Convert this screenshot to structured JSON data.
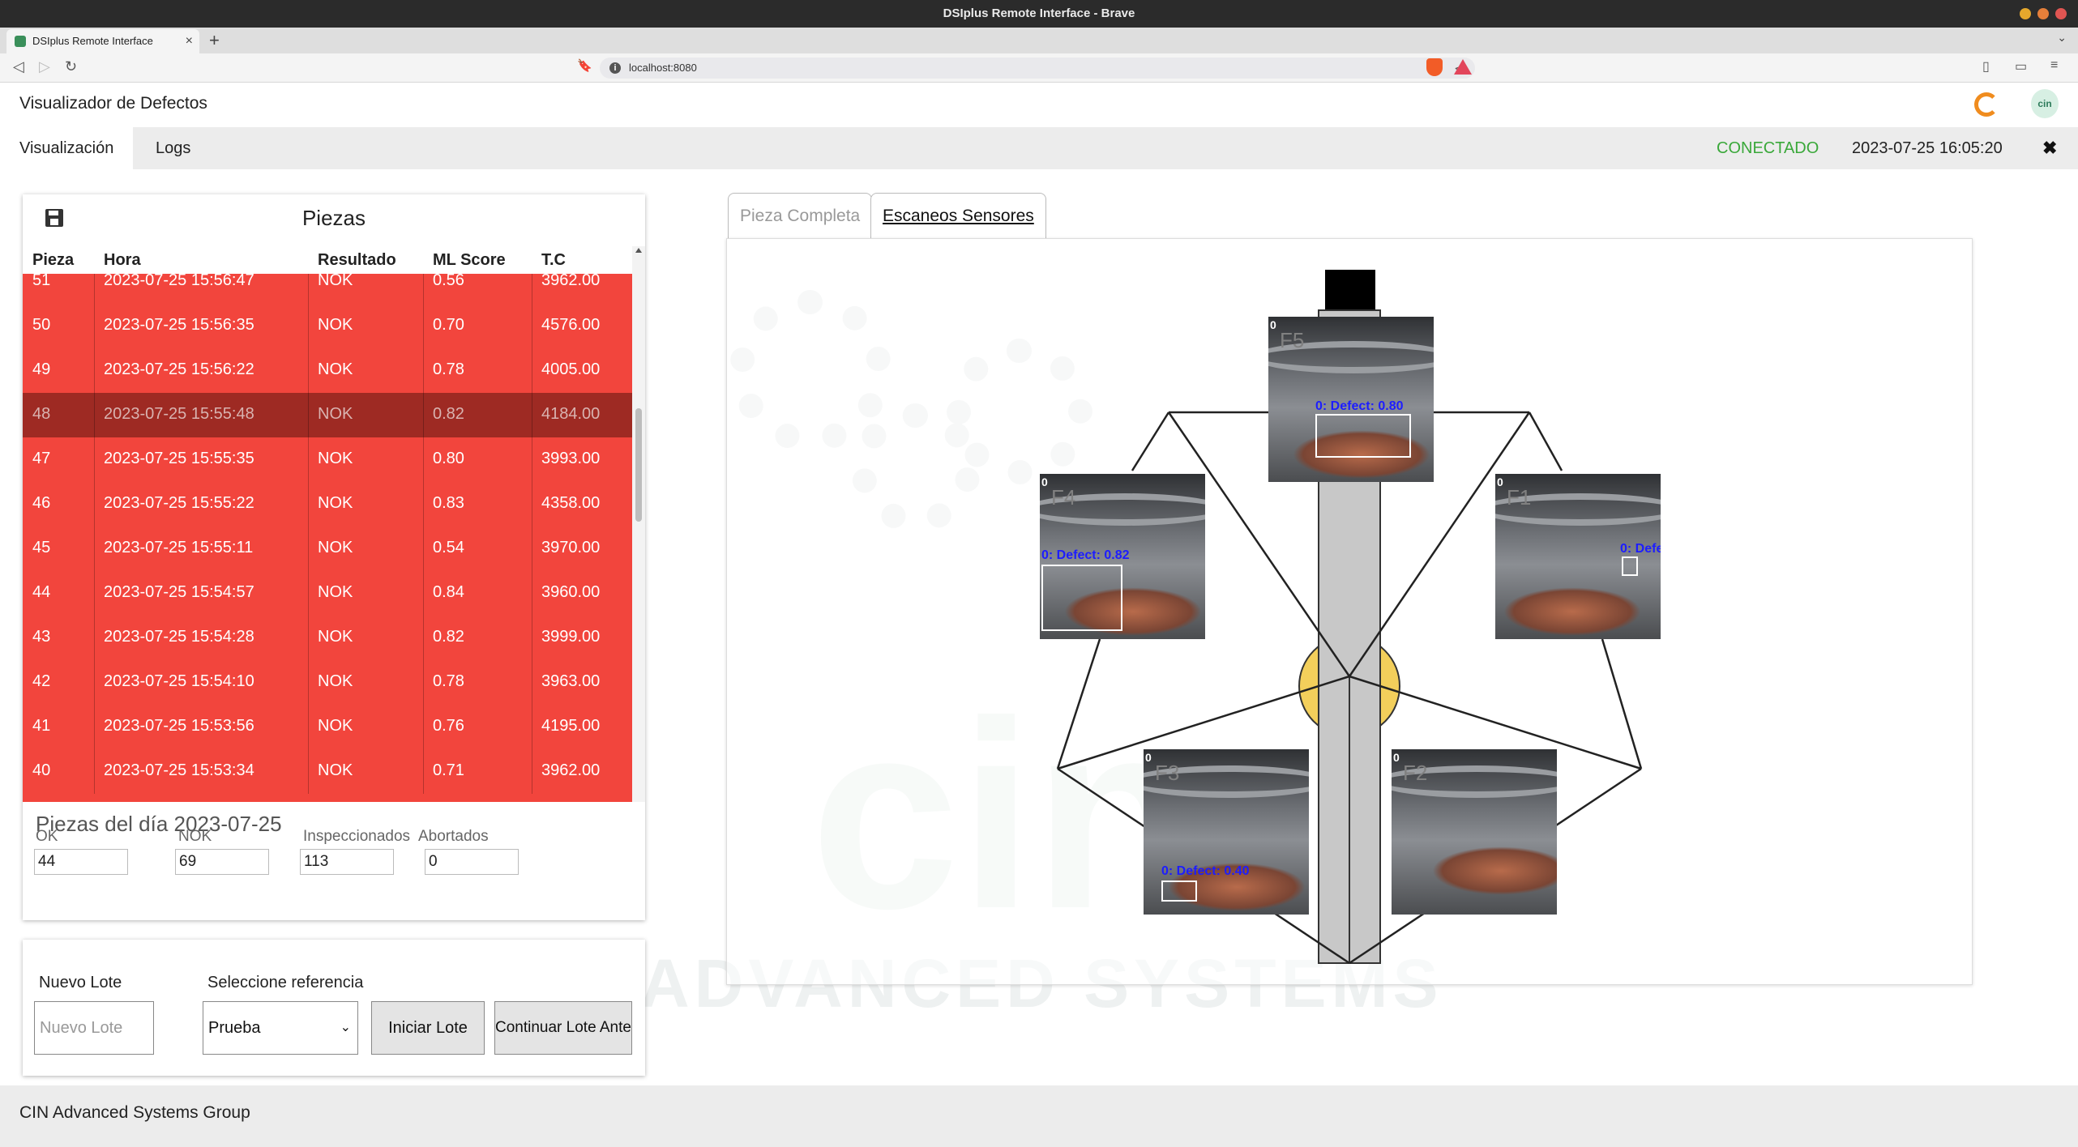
{
  "browser": {
    "window_title": "DSIplus Remote Interface - Brave",
    "tab_title": "DSIplus Remote Interface",
    "url": "localhost:8080"
  },
  "app": {
    "title": "Visualizador de Defectos",
    "nav": [
      "Visualización",
      "Logs"
    ],
    "status": "CONECTADO",
    "datetime": "2023-07-25 16:05:20",
    "close_icon": "close-icon",
    "status_color": "#3aa83a"
  },
  "piezas": {
    "title": "Piezas",
    "columns": [
      "Pieza",
      "Hora",
      "Resultado",
      "ML Score",
      "T.C"
    ],
    "rows": [
      {
        "pieza": "51",
        "hora": "2023-07-25 15:56:47",
        "resultado": "NOK",
        "ml": "0.56",
        "tc": "3962.00"
      },
      {
        "pieza": "50",
        "hora": "2023-07-25 15:56:35",
        "resultado": "NOK",
        "ml": "0.70",
        "tc": "4576.00"
      },
      {
        "pieza": "49",
        "hora": "2023-07-25 15:56:22",
        "resultado": "NOK",
        "ml": "0.78",
        "tc": "4005.00"
      },
      {
        "pieza": "48",
        "hora": "2023-07-25 15:55:48",
        "resultado": "NOK",
        "ml": "0.82",
        "tc": "4184.00"
      },
      {
        "pieza": "47",
        "hora": "2023-07-25 15:55:35",
        "resultado": "NOK",
        "ml": "0.80",
        "tc": "3993.00"
      },
      {
        "pieza": "46",
        "hora": "2023-07-25 15:55:22",
        "resultado": "NOK",
        "ml": "0.83",
        "tc": "4358.00"
      },
      {
        "pieza": "45",
        "hora": "2023-07-25 15:55:11",
        "resultado": "NOK",
        "ml": "0.54",
        "tc": "3970.00"
      },
      {
        "pieza": "44",
        "hora": "2023-07-25 15:54:57",
        "resultado": "NOK",
        "ml": "0.84",
        "tc": "3960.00"
      },
      {
        "pieza": "43",
        "hora": "2023-07-25 15:54:28",
        "resultado": "NOK",
        "ml": "0.82",
        "tc": "3999.00"
      },
      {
        "pieza": "42",
        "hora": "2023-07-25 15:54:10",
        "resultado": "NOK",
        "ml": "0.78",
        "tc": "3963.00"
      },
      {
        "pieza": "41",
        "hora": "2023-07-25 15:53:56",
        "resultado": "NOK",
        "ml": "0.76",
        "tc": "4195.00"
      },
      {
        "pieza": "40",
        "hora": "2023-07-25 15:53:34",
        "resultado": "NOK",
        "ml": "0.71",
        "tc": "3962.00"
      }
    ],
    "row_color": "#f2453d",
    "selected_row_color": "#9e2a23"
  },
  "dia": {
    "title": "Piezas del día 2023-07-25",
    "labels": [
      "OK",
      "NOK",
      "Inspeccionados",
      "Abortados"
    ],
    "values": [
      "44",
      "69",
      "113",
      "0"
    ]
  },
  "lote": {
    "nuevo_label": "Nuevo Lote",
    "nuevo_placeholder": "Nuevo Lote",
    "ref_label": "Seleccione referencia",
    "ref_value": "Prueba",
    "iniciar": "Iniciar Lote",
    "continuar": "Continuar Lote Anterior"
  },
  "viewer": {
    "tabs": [
      "Pieza Completa",
      "Escaneos Sensores"
    ],
    "watermark": "ADVANCED SYSTEMS",
    "cams": [
      {
        "id": "F5",
        "zero": "0",
        "defect": "0: Defect: 0.80"
      },
      {
        "id": "F4",
        "zero": "0",
        "defect": "0: Defect: 0.82"
      },
      {
        "id": "F1",
        "zero": "0",
        "defect": "0: Defe"
      },
      {
        "id": "F3",
        "zero": "0",
        "defect": "0: Defect: 0.40"
      },
      {
        "id": "F2",
        "zero": "0",
        "defect": ""
      }
    ]
  },
  "footer": "CIN Advanced Systems Group"
}
